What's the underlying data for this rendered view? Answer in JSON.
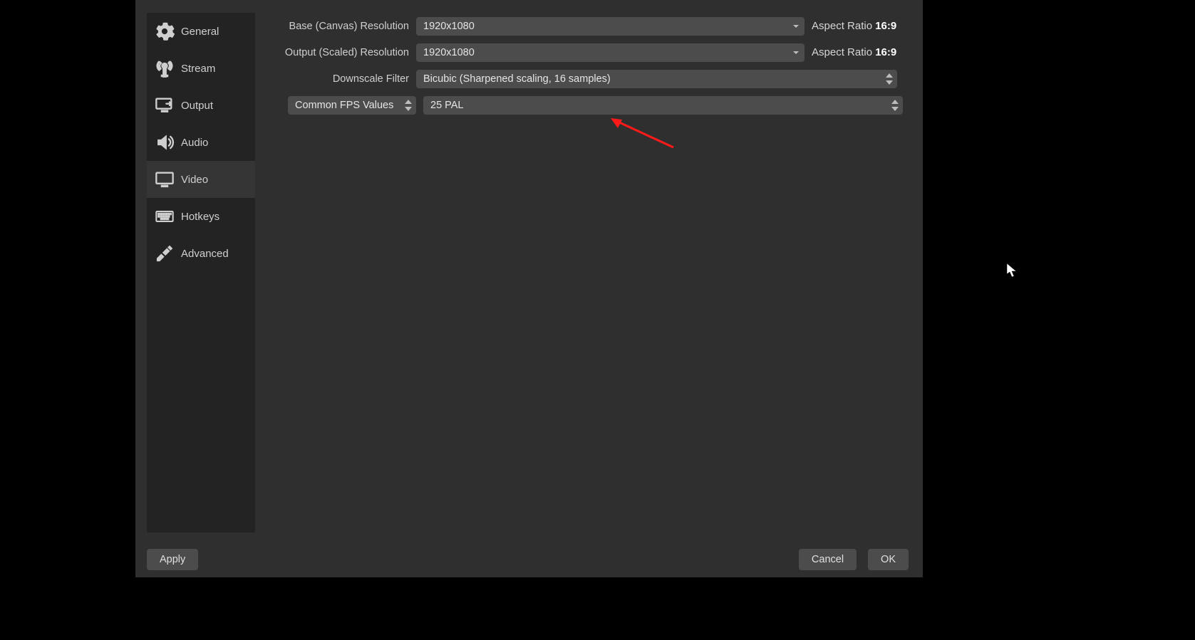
{
  "sidebar": {
    "items": [
      {
        "label": "General"
      },
      {
        "label": "Stream"
      },
      {
        "label": "Output"
      },
      {
        "label": "Audio"
      },
      {
        "label": "Video"
      },
      {
        "label": "Hotkeys"
      },
      {
        "label": "Advanced"
      }
    ]
  },
  "video": {
    "base_label": "Base (Canvas) Resolution",
    "base_value": "1920x1080",
    "base_aspect_label": "Aspect Ratio",
    "base_aspect_value": "16:9",
    "output_label": "Output (Scaled) Resolution",
    "output_value": "1920x1080",
    "output_aspect_label": "Aspect Ratio",
    "output_aspect_value": "16:9",
    "filter_label": "Downscale Filter",
    "filter_value": "Bicubic (Sharpened scaling, 16 samples)",
    "fps_type_label": "Common FPS Values",
    "fps_value": "25 PAL"
  },
  "footer": {
    "apply": "Apply",
    "cancel": "Cancel",
    "ok": "OK"
  }
}
